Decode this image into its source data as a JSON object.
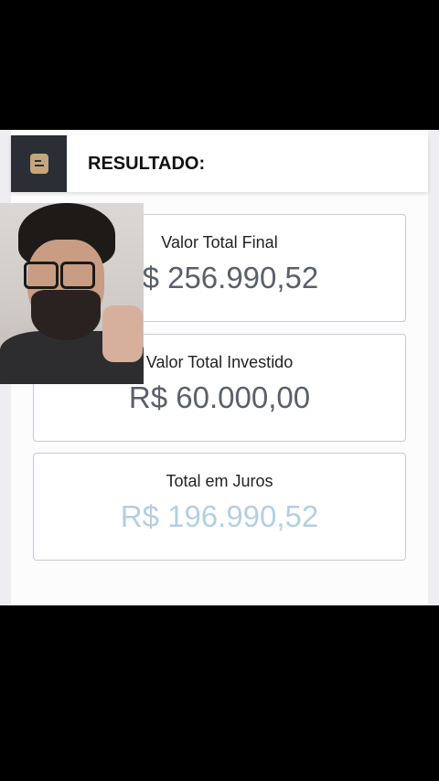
{
  "header": {
    "title": "RESULTADO:",
    "icon": "document-icon"
  },
  "results": [
    {
      "label": "Valor Total Final",
      "value": "R$ 256.990,52"
    },
    {
      "label": "Valor Total Investido",
      "value": "R$ 60.000,00"
    },
    {
      "label": "Total em Juros",
      "value": "R$ 196.990,52"
    }
  ],
  "colors": {
    "header_icon_bg": "#2b2f35",
    "icon_accent": "#c6a57c",
    "value_dark": "#5b6068",
    "value_light": "#b5cfe0"
  }
}
